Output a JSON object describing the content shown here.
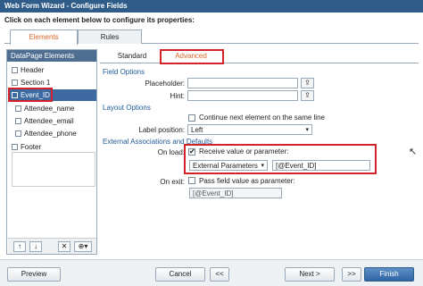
{
  "window": {
    "title": "Web Form Wizard - Configure Fields"
  },
  "instructions": "Click on each element below to configure its properties:",
  "tabs": [
    {
      "label": "Elements"
    },
    {
      "label": "Rules"
    }
  ],
  "left_panel": {
    "header": "DataPage Elements",
    "items": [
      {
        "label": "Header"
      },
      {
        "label": "Section 1"
      },
      {
        "label": "Event_ID"
      },
      {
        "label": "Attendee_name"
      },
      {
        "label": "Attendee_email"
      },
      {
        "label": "Attendee_phone"
      },
      {
        "label": "Footer"
      }
    ],
    "toolbar": {
      "up": "↑",
      "down": "↓",
      "delete": "✕",
      "add": "⊕▾"
    }
  },
  "sub_tabs": [
    {
      "label": "Standard"
    },
    {
      "label": "Advanced"
    }
  ],
  "field_options": {
    "heading": "Field Options",
    "placeholder_label": "Placeholder:",
    "placeholder_value": "",
    "hint_label": "Hint:",
    "hint_value": ""
  },
  "layout_options": {
    "heading": "Layout Options",
    "continue_label": "Continue next element on the same line",
    "continue_checked": false,
    "label_position_label": "Label position:",
    "label_position_value": "Left"
  },
  "external": {
    "heading": "External Associations and Defaults",
    "on_load_label": "On load:",
    "receive_label": "Receive value or parameter:",
    "receive_checked": true,
    "source_value": "External Parameters",
    "param_value": "[@Event_ID]",
    "on_exit_label": "On exit:",
    "pass_label": "Pass field value as parameter:",
    "pass_checked": false,
    "pass_value": "[@Event_ID]"
  },
  "footer": {
    "preview": "Preview",
    "cancel": "Cancel",
    "first": "<<",
    "next": "Next >",
    "last": ">>",
    "finish": "Finish"
  },
  "colors": {
    "title_bar": "#2f5c88",
    "accent_orange": "#d9682b",
    "highlight_red": "#d2222a",
    "selection_blue": "#3c6aa1"
  }
}
